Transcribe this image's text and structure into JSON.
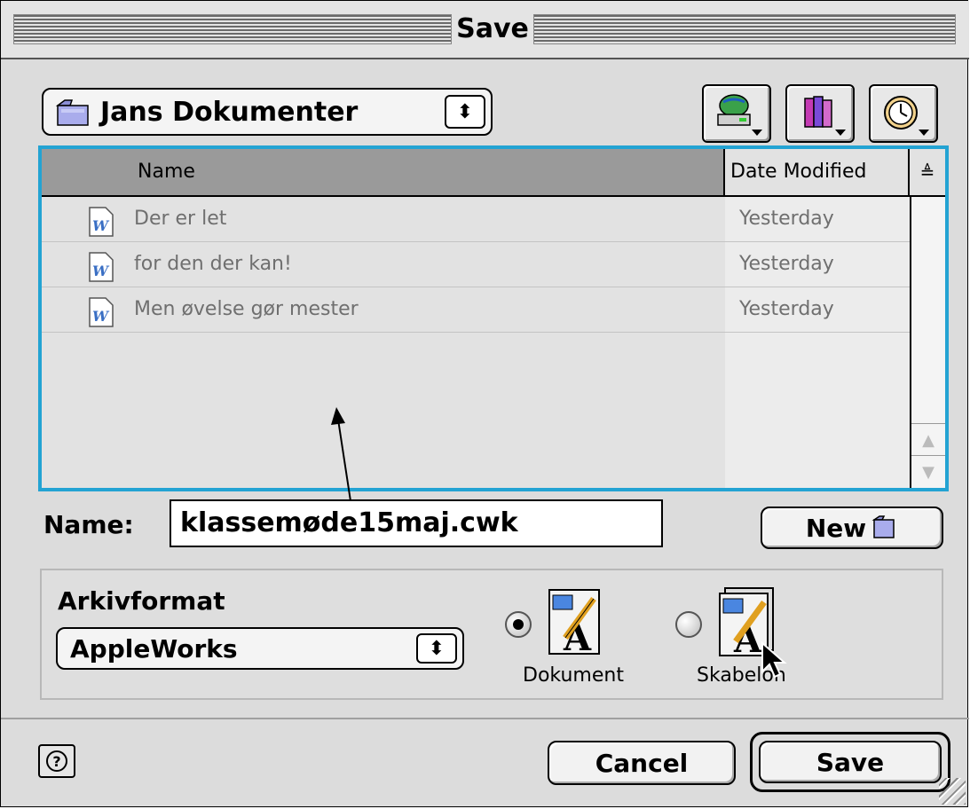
{
  "window": {
    "title": "Save"
  },
  "location_popup": {
    "label": "Jans Dokumenter",
    "icon": "folder-icon"
  },
  "nav_buttons": [
    {
      "name": "shortcuts-button",
      "icon": "network-drive-icon"
    },
    {
      "name": "favorites-button",
      "icon": "favorites-books-icon"
    },
    {
      "name": "recent-button",
      "icon": "clock-icon"
    }
  ],
  "file_list": {
    "columns": {
      "name": "Name",
      "date": "Date Modified"
    },
    "sort_indicator": "≜",
    "rows": [
      {
        "name": "Der er let",
        "date": "Yesterday",
        "icon": "word-document-icon"
      },
      {
        "name": "for den der kan!",
        "date": "Yesterday",
        "icon": "word-document-icon"
      },
      {
        "name": "Men øvelse gør mester",
        "date": "Yesterday",
        "icon": "word-document-icon"
      }
    ]
  },
  "name_field": {
    "label": "Name:",
    "value": "klassemøde15maj.cwk"
  },
  "new_folder_button": {
    "label": "New"
  },
  "format": {
    "group_label": "Arkivformat",
    "popup_value": "AppleWorks",
    "options": [
      {
        "label": "Dokument",
        "selected": true
      },
      {
        "label": "Skabelon",
        "selected": false
      }
    ]
  },
  "buttons": {
    "cancel": "Cancel",
    "save": "Save",
    "help": "?"
  },
  "colors": {
    "list_focus": "#23a3d3",
    "window_bg": "#dcdcdc"
  }
}
